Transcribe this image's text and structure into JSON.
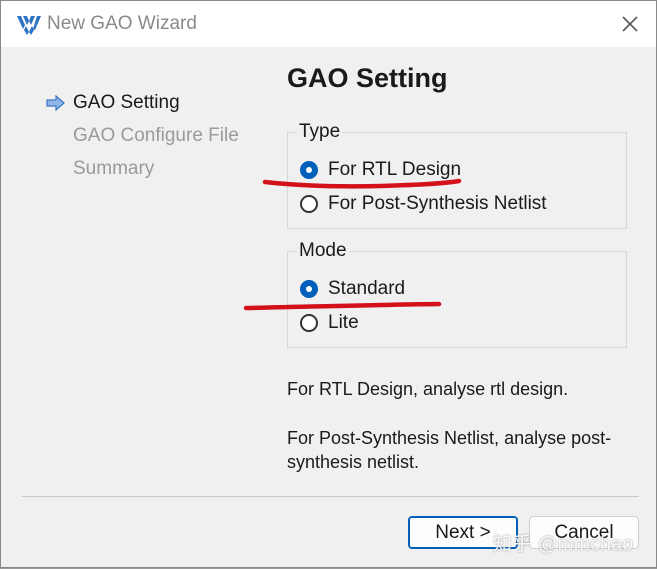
{
  "window": {
    "title": "New GAO Wizard"
  },
  "steps": [
    {
      "label": "GAO Setting",
      "active": true
    },
    {
      "label": "GAO Configure File",
      "active": false
    },
    {
      "label": "Summary",
      "active": false
    }
  ],
  "page_title": "GAO Setting",
  "type_group": {
    "label": "Type",
    "options": [
      {
        "label": "For RTL Design",
        "checked": true
      },
      {
        "label": "For Post-Synthesis Netlist",
        "checked": false
      }
    ]
  },
  "mode_group": {
    "label": "Mode",
    "options": [
      {
        "label": "Standard",
        "checked": true
      },
      {
        "label": "Lite",
        "checked": false
      }
    ]
  },
  "descriptions": {
    "rtl": "For RTL Design, analyse rtl design.",
    "post_line1": "For Post-Synthesis Netlist, analyse post-",
    "post_line2": "synthesis netlist."
  },
  "buttons": {
    "next": "Next >",
    "cancel": "Cancel"
  },
  "watermark": "知乎 @mmchao",
  "colors": {
    "accent": "#005fb8",
    "annotation": "#d4111b"
  }
}
